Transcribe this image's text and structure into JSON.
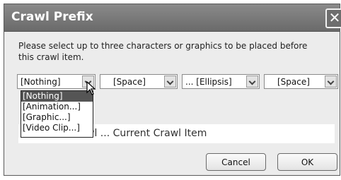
{
  "dialog": {
    "title": "Crawl Prefix",
    "close_glyph": "✕",
    "message": "Please select up to three characters or graphics to be placed before this crawl item."
  },
  "combos": [
    {
      "value": "[Nothing]"
    },
    {
      "value": "[Space]"
    },
    {
      "value": "... [Ellipsis]"
    },
    {
      "value": "[Space]"
    }
  ],
  "dropdown": {
    "options": [
      "[Nothing]",
      "[Animation...]",
      "[Graphic...]",
      "[Video Clip...]"
    ],
    "selected_index": 0
  },
  "preview": {
    "text": "wl ... Current Crawl Item"
  },
  "buttons": {
    "cancel": "Cancel",
    "ok": "OK"
  }
}
